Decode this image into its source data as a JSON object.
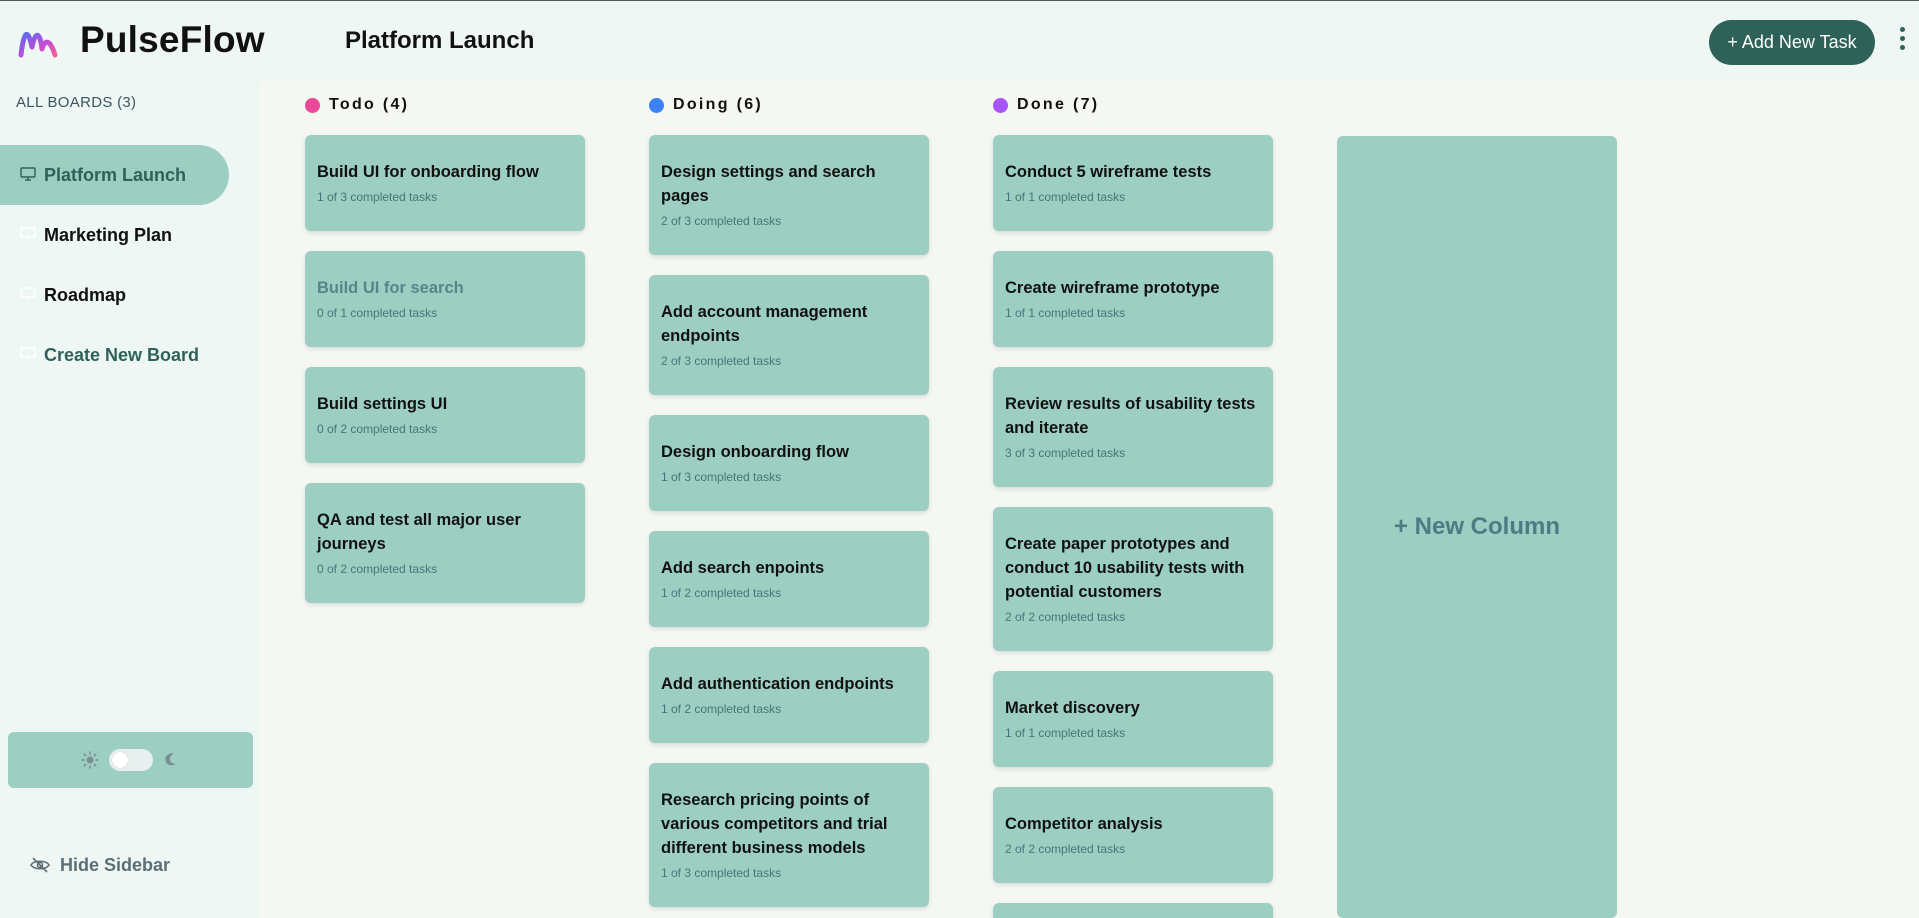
{
  "app": {
    "name": "PulseFlow"
  },
  "header": {
    "board_title": "Platform Launch",
    "add_task_label": "+ Add New Task"
  },
  "sidebar": {
    "all_boards_label": "ALL BOARDS (3)",
    "items": [
      {
        "label": "Platform Launch",
        "active": true
      },
      {
        "label": "Marketing Plan",
        "active": false
      },
      {
        "label": "Roadmap",
        "active": false
      },
      {
        "label": "Create New Board",
        "active": false
      }
    ],
    "hide_label": "Hide Sidebar"
  },
  "theme": {
    "mode": "light"
  },
  "colors": {
    "accent": "#2e6258",
    "card": "#9ccec2",
    "todo": "#ec4899",
    "doing": "#3b82f6",
    "done": "#a855f7"
  },
  "columns": [
    {
      "title": "Todo (4)",
      "dot_color": "#ec4899",
      "tasks": [
        {
          "title": "Build UI for onboarding flow",
          "subtasks": "1 of 3 completed tasks"
        },
        {
          "title": "Build UI for search",
          "subtasks": "0 of 1 completed tasks"
        },
        {
          "title": "Build settings UI",
          "subtasks": "0 of 2 completed tasks"
        },
        {
          "title": "QA and test all major user journeys",
          "subtasks": "0 of 2 completed tasks"
        }
      ]
    },
    {
      "title": "Doing (6)",
      "dot_color": "#3b82f6",
      "tasks": [
        {
          "title": "Design settings and search pages",
          "subtasks": "2 of 3 completed tasks"
        },
        {
          "title": "Add account management endpoints",
          "subtasks": "2 of 3 completed tasks"
        },
        {
          "title": "Design onboarding flow",
          "subtasks": "1 of 3 completed tasks"
        },
        {
          "title": "Add search enpoints",
          "subtasks": "1 of 2 completed tasks"
        },
        {
          "title": "Add authentication endpoints",
          "subtasks": "1 of 2 completed tasks"
        },
        {
          "title": "Research pricing points of various competitors and trial different business models",
          "subtasks": "1 of 3 completed tasks"
        }
      ]
    },
    {
      "title": "Done (7)",
      "dot_color": "#a855f7",
      "tasks": [
        {
          "title": "Conduct 5 wireframe tests",
          "subtasks": "1 of 1 completed tasks"
        },
        {
          "title": "Create wireframe prototype",
          "subtasks": "1 of 1 completed tasks"
        },
        {
          "title": "Review results of usability tests and iterate",
          "subtasks": "3 of 3 completed tasks"
        },
        {
          "title": "Create paper prototypes and conduct 10 usability tests with potential customers",
          "subtasks": "2 of 2 completed tasks"
        },
        {
          "title": "Market discovery",
          "subtasks": "1 of 1 completed tasks"
        },
        {
          "title": "Competitor analysis",
          "subtasks": "2 of 2 completed tasks"
        }
      ]
    }
  ],
  "new_column_label": "+ New Column"
}
